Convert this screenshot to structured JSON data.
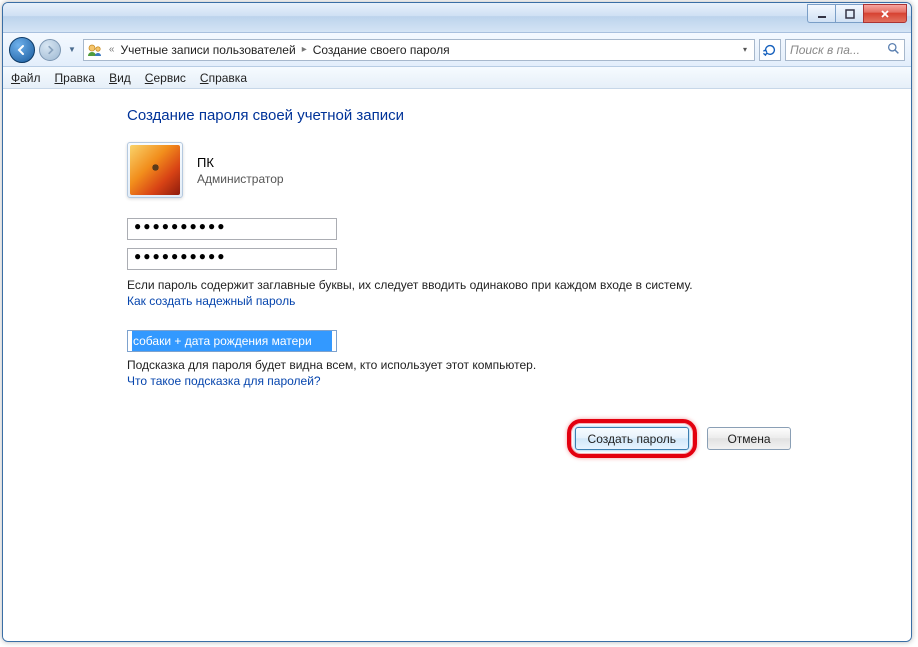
{
  "titlebar": {
    "min_tip": "Свернуть",
    "max_tip": "Развернуть",
    "close_tip": "Закрыть"
  },
  "nav": {
    "back_tip": "Назад",
    "forward_tip": "Вперёд",
    "chevrons": "«",
    "crumb1": "Учетные записи пользователей",
    "crumb2": "Создание своего пароля",
    "refresh_tip": "Обновить",
    "search_placeholder": "Поиск в па..."
  },
  "menu": {
    "file_u": "Ф",
    "file_r": "айл",
    "edit_u": "П",
    "edit_r": "равка",
    "view_u": "В",
    "view_r": "ид",
    "tools_u": "С",
    "tools_r": "ервис",
    "help_u": "С",
    "help_r": "правка"
  },
  "main": {
    "heading": "Создание пароля своей учетной записи",
    "user_name": "ПК",
    "user_role": "Администратор",
    "password1": "●●●●●●●●●●",
    "password2": "●●●●●●●●●●",
    "caps_note": "Если пароль содержит заглавные буквы, их следует вводить одинаково при каждом входе в систему.",
    "strong_link": "Как создать надежный пароль",
    "hint_value": "собаки + дата рождения матери",
    "hint_note": "Подсказка для пароля будет видна всем, кто использует этот компьютер.",
    "hint_link": "Что такое подсказка для паролей?",
    "create_btn": "Создать пароль",
    "cancel_btn": "Отмена"
  }
}
